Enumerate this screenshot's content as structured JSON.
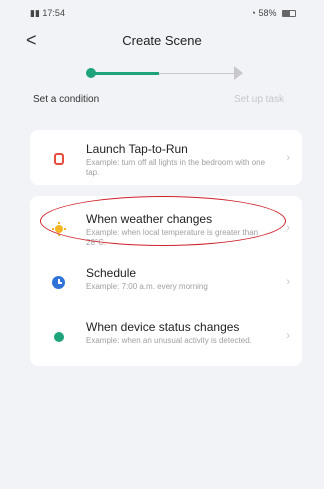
{
  "status_bar": {
    "time": "17:54",
    "left_extra": "ll ⊙",
    "right_text": "58%"
  },
  "header": {
    "title": "Create Scene",
    "back_glyph": "<"
  },
  "stepper": {
    "step1_label": "Set a condition",
    "step2_label": "Set up task",
    "active_step": 1,
    "accent_color": "#1fa37a"
  },
  "conditions": [
    {
      "title": "Launch Tap-to-Run",
      "desc": "Example: turn off all lights in the bedroom with one tap.",
      "icon": "tap-icon"
    },
    {
      "title": "When weather changes",
      "desc": "Example: when local temperature is greater than 28°C.",
      "icon": "sun-icon"
    },
    {
      "title": "Schedule",
      "desc": "Example: 7:00 a.m. every morning",
      "icon": "clock-icon"
    },
    {
      "title": "When device status changes",
      "desc": "Example: when an unusual activity is detected.",
      "icon": "device-icon"
    }
  ]
}
